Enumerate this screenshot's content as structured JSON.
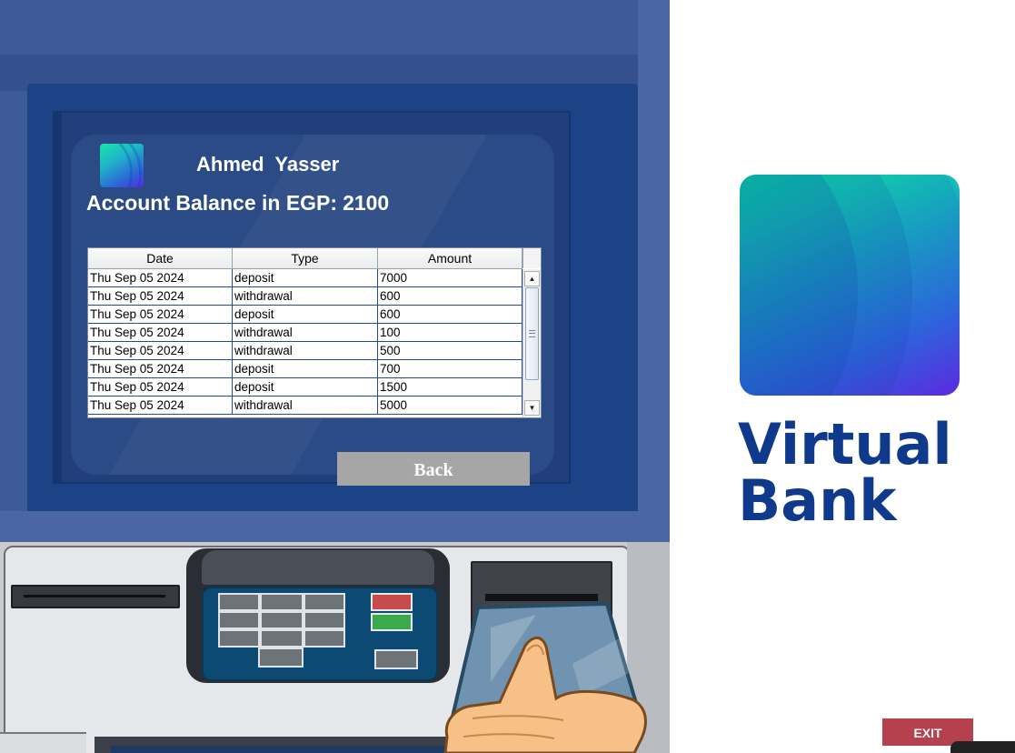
{
  "account": {
    "holder_name": "Ahmed  Yasser",
    "balance_label": "Account Balance in EGP:",
    "balance_value": "2100"
  },
  "transactions": {
    "columns": [
      "Date",
      "Type",
      "Amount"
    ],
    "rows": [
      [
        "Thu Sep 05 2024",
        "deposit",
        "7000"
      ],
      [
        "Thu Sep 05 2024",
        "withdrawal",
        "600"
      ],
      [
        "Thu Sep 05 2024",
        "deposit",
        "600"
      ],
      [
        "Thu Sep 05 2024",
        "withdrawal",
        "100"
      ],
      [
        "Thu Sep 05 2024",
        "withdrawal",
        "500"
      ],
      [
        "Thu Sep 05 2024",
        "deposit",
        "700"
      ],
      [
        "Thu Sep 05 2024",
        "deposit",
        "1500"
      ],
      [
        "Thu Sep 05 2024",
        "withdrawal",
        "5000"
      ]
    ]
  },
  "actions": {
    "back_label": "Back",
    "exit_label": "EXIT"
  },
  "brand": {
    "line1": "Virtual",
    "line2": "Bank"
  },
  "colors": {
    "brand_text": "#0f3a8c",
    "exit_button": "#b5414f",
    "back_button": "#a6a6a6",
    "atm_screen": "#2b4b86"
  },
  "icons": {
    "scroll_up": "▲",
    "scroll_down": "▼"
  }
}
